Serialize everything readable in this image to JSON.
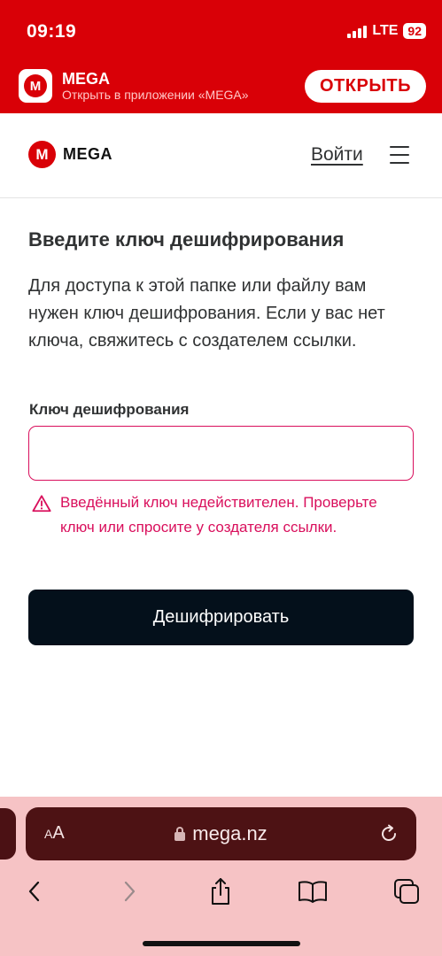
{
  "status_bar": {
    "time": "09:19",
    "network": "LTE",
    "battery": "92"
  },
  "smart_banner": {
    "app_icon_letter": "M",
    "app_name": "MEGA",
    "subtitle": "Открыть в приложении «MEGA»",
    "open_label": "ОТКРЫТЬ"
  },
  "header": {
    "logo_letter": "M",
    "logo_text": "MEGA",
    "login_label": "Войти",
    "menu_icon": "hamburger-menu-icon"
  },
  "main": {
    "heading": "Введите ключ дешифрирования",
    "description": "Для доступа к этой папке или файлу вам нужен ключ дешифрования. Если у вас нет ключа, свяжитесь с создателем ссылки.",
    "field_label": "Ключ дешифрования",
    "input_value": "",
    "input_placeholder": "",
    "error_icon": "warning-icon",
    "error_text": "Введённый ключ недействителен. Проверьте ключ или спросите у создателя ссылки.",
    "decrypt_label": "Дешифрировать"
  },
  "safari": {
    "aa_small": "A",
    "aa_large": "A",
    "url": "mega.nz",
    "icons": [
      "lock-icon",
      "reload-icon",
      "back-icon",
      "forward-icon",
      "share-icon",
      "bookmarks-icon",
      "tabs-icon"
    ]
  },
  "colors": {
    "brand_red": "#d90007",
    "error_pink": "#d90f5c",
    "button_dark": "#04101b",
    "text_dark": "#303233",
    "safari_bg": "#f6c3c5"
  }
}
